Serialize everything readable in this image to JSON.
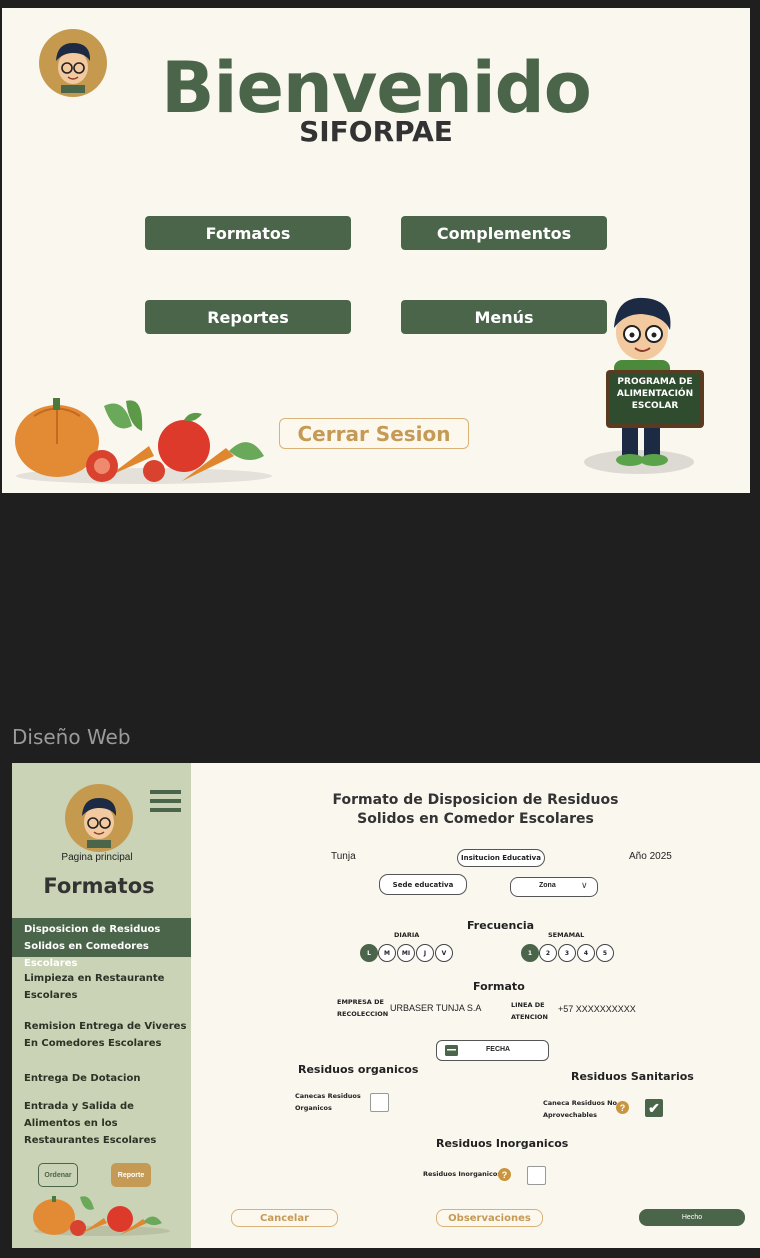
{
  "welcome": {
    "title": "Bienvenido",
    "subtitle": "SIFORPAE",
    "buttons": [
      "Formatos",
      "Complementos",
      "Reportes",
      "Menús"
    ],
    "logout": "Cerrar Sesion",
    "sign": "PROGRAMA DE ALIMENTACIÓN ESCOLAR"
  },
  "section_label": "Diseño Web",
  "sidebar": {
    "home_label": "Pagina principal",
    "heading": "Formatos",
    "items": [
      "Disposicion de Residuos Solidos en Comedores Escolares",
      "Limpieza en Restaurante Escolares",
      "Remision Entrega de Viveres En Comedores Escolares",
      "Entrega De Dotacion",
      "Entrada y Salida de Alimentos en los  Restaurantes Escolares"
    ],
    "order_button": "Ordenar",
    "report_button": "Reporte"
  },
  "form": {
    "title_line1": "Formato de Disposicion de Residuos",
    "title_line2": "Solidos en Comedor Escolares",
    "city": "Tunja",
    "institution": "Insitucion Educativa",
    "year": "Año 2025",
    "sede": "Sede educativa",
    "zona": "Zona",
    "frequency_heading": "Frecuencia",
    "daily_label": "DIARIA",
    "weekly_label": "SEMAMAL",
    "daily_options": [
      "L",
      "M",
      "MI",
      "J",
      "V"
    ],
    "weekly_options": [
      "1",
      "2",
      "3",
      "4",
      "5"
    ],
    "format_heading": "Formato",
    "company_label_1": "EMPRESA DE",
    "company_label_2": "RECOLECCION",
    "company_value": "URBASER TUNJA S.A",
    "line_label_1": "LINEA DE",
    "line_label_2": "ATENCION",
    "line_value": "+57 XXXXXXXXXX",
    "date_label": "FECHA",
    "organic_heading": "Residuos organicos",
    "organic_label_1": "Canecas Residuos",
    "organic_label_2": "Organicos",
    "sanitary_heading": "Residuos Sanitarios",
    "sanitary_label_1": "Caneca Residuos No",
    "sanitary_label_2": "Aprovechables",
    "inorganic_heading": "Residuos Inorganicos",
    "inorganic_label": "Residuos Inorganicos",
    "cancel": "Cancelar",
    "observations": "Observaciones",
    "done": "Hecho"
  },
  "colors": {
    "brand_green": "#4a6549",
    "gold": "#c49a55",
    "cream": "#faf7ee",
    "sidebar": "#cbd3b6"
  }
}
